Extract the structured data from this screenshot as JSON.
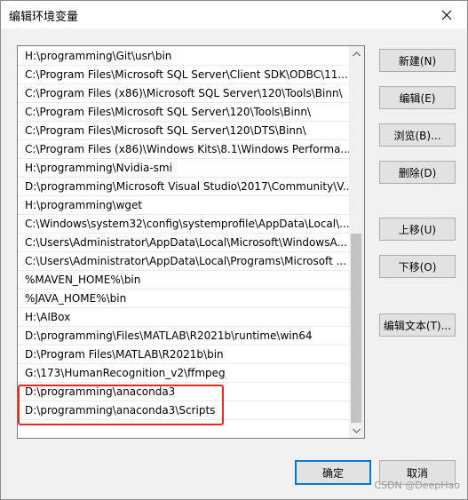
{
  "window": {
    "title": "编辑环境变量"
  },
  "paths": [
    "H:\\programming\\Git\\usr\\bin",
    "C:\\Program Files\\Microsoft SQL Server\\Client SDK\\ODBC\\11...",
    "C:\\Program Files (x86)\\Microsoft SQL Server\\120\\Tools\\Binn\\",
    "C:\\Program Files\\Microsoft SQL Server\\120\\Tools\\Binn\\",
    "C:\\Program Files\\Microsoft SQL Server\\120\\DTS\\Binn\\",
    "C:\\Program Files (x86)\\Windows Kits\\8.1\\Windows Performa...",
    "H:\\programming\\Nvidia-smi",
    "D:\\programming\\Microsoft Visual Studio\\2017\\Community\\V...",
    "H:\\programming\\wget",
    "C:\\Windows\\system32\\config\\systemprofile\\AppData\\Local\\...",
    "C:\\Users\\Administrator\\AppData\\Local\\Microsoft\\WindowsA...",
    "C:\\Users\\Administrator\\AppData\\Local\\Programs\\Microsoft ...",
    "%MAVEN_HOME%\\bin",
    "%JAVA_HOME%\\bin",
    "H:\\AIBox",
    "D:\\programming\\Files\\MATLAB\\R2021b\\runtime\\win64",
    "D:\\Program Files\\MATLAB\\R2021b\\bin",
    "G:\\173\\HumanRecognition_v2\\ffmpeg",
    "D:\\programming\\anaconda3",
    "D:\\programming\\anaconda3\\Scripts"
  ],
  "buttons": {
    "new": "新建(N)",
    "edit": "编辑(E)",
    "browse": "浏览(B)...",
    "delete": "删除(D)",
    "move_up": "上移(U)",
    "move_down": "下移(O)",
    "edit_text": "编辑文本(T)...",
    "ok": "确定",
    "cancel": "取消"
  },
  "watermark": "CSDN @DeepHao",
  "colors": {
    "highlight": "#e32b22",
    "default_button_border": "#0078d7"
  }
}
